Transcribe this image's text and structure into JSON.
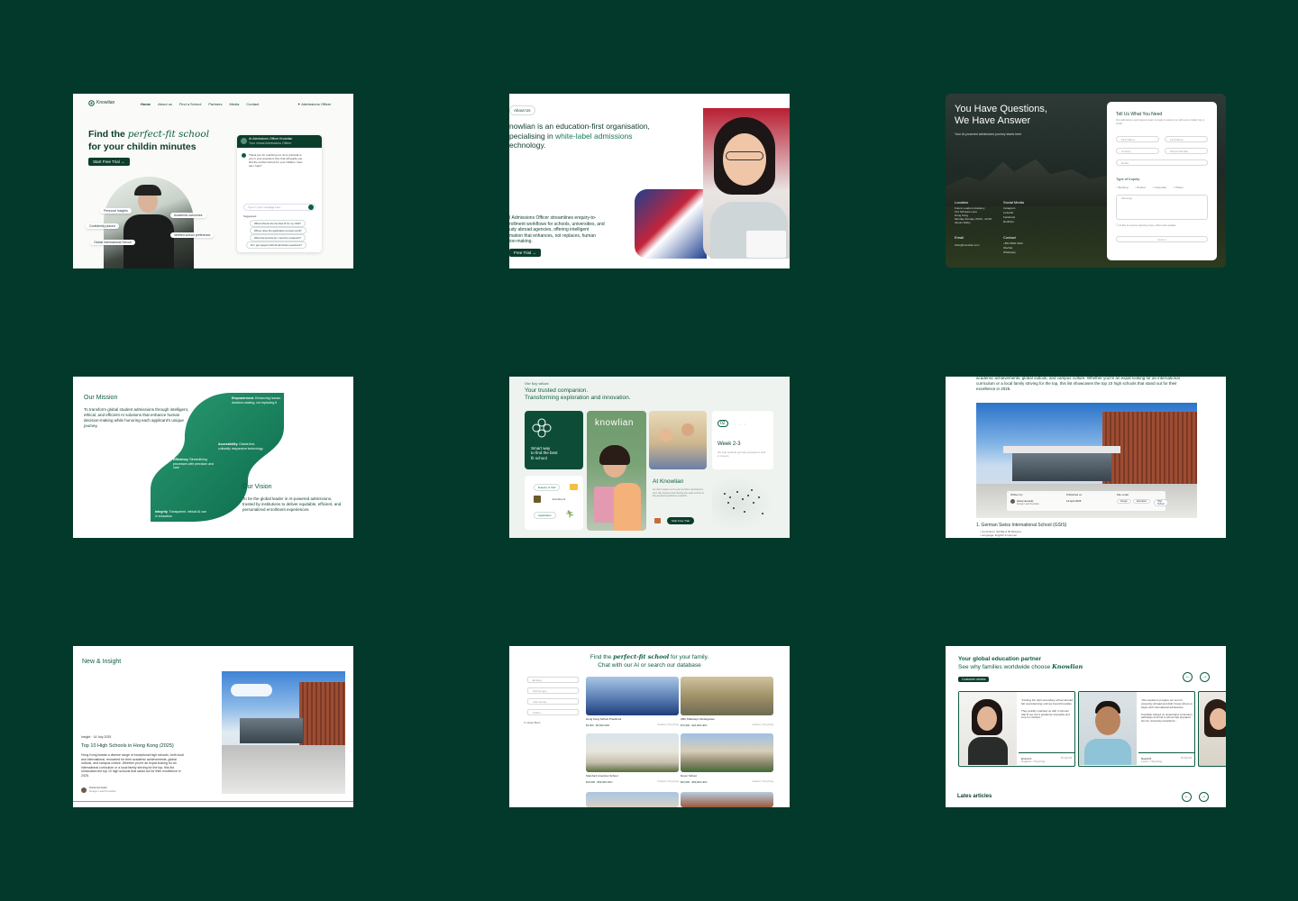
{
  "colors": {
    "page_bg": "#03392a",
    "brand": "#0f5c41",
    "brand_dark": "#0b3d2c",
    "accent_light": "#e8f3ee"
  },
  "hero": {
    "logo": "Knowlian",
    "nav": [
      "Home",
      "About us",
      "Find a School",
      "Partners",
      "Media",
      "Contact"
    ],
    "nav_cta": "Admissions Officer",
    "title_a": "Find the ",
    "title_em": "perfect-fit school",
    "title_b": "for your childin minutes",
    "cta": "Start Free Trial",
    "chat_header": "AI Admissions Officer Knowlian",
    "chat_sub": "Your virtual Admissions Officer",
    "chat_msg": "Thank you for reaching out. As a principal to you in your questions this chat will guide you find the perfect school for your children. How can i help?",
    "chat_input": "Type in your message here",
    "suggested": "Suggested",
    "suggestions": [
      "What schools are the best fit for my child?",
      "Where does the application process work?",
      "What documents do I need for prospects?",
      "Do I get support with all admission questions?"
    ],
    "chips": [
      "Personal Insights",
      "Confidently placed",
      "Global International School",
      "Academic outcomes",
      "Verified school preference"
    ]
  },
  "about": {
    "badge": "About Us",
    "heading_a": "nowlian is an education-first organisation,",
    "heading_b": "pecialising in ",
    "heading_hl": "white-label admissions",
    "heading_c": "echnology.",
    "para": "I Admissions Officer streamlines enquiry-to-\nrollment workflows for schools, universities, and\nudy abroad agencies, offering intelligent\nmation that enhances, not replaces, human\nion-making.",
    "cta": "Free Trial"
  },
  "contact": {
    "heading": "You Have Questions,\nWe Have Answer",
    "sub": "Your AI-powered admissions journey starts here",
    "location_label": "Location",
    "location": "Future Leaders Academy\n101 Scholars Lane\nHong Kong\nMonday-Sunday, 09:00 - 22:00\n(Hours Daily)",
    "social_label": "Social Media",
    "social": [
      "Instagram",
      "LinkedIn",
      "Facebook",
      "RedNote"
    ],
    "email_label": "Email",
    "email": "hello@knowlian.com",
    "contact_label": "Contact",
    "contact_values": [
      "+852 9800 4232",
      "Wechat",
      "WhatsApp"
    ],
    "form_title": "Tell Us What You Need",
    "form_sub": "Our admissions and support team is ready to assist you with every detail, big or small.",
    "fields": [
      "First Name",
      "Last Name",
      "Country",
      "Phone Number",
      "Email"
    ],
    "inquiry_label": "Type of Inquiry",
    "inquiry_options": [
      "Booking",
      "Partner",
      "Corporate",
      "Others"
    ],
    "message": "Message",
    "consent": "I'd like to receive learning news, offers and updates",
    "submit": "Submit"
  },
  "mission": {
    "mission_title": "Our Mission",
    "mission_text": "To transform global student admissions through intelligent, ethical, and efficient AI solutions that enhance human decision-making while honoring each applicant's unique journey.",
    "values": [
      {
        "title": "Empowerment.",
        "text": "Enhancing human decision-making, not replacing it"
      },
      {
        "title": "Accessibility.",
        "text": "Global-first, culturally responsive technology"
      },
      {
        "title": "Efficiency.",
        "text": "Streamlining processes with precision and care"
      },
      {
        "title": "Integrity.",
        "text": "Transparent, ethical AI use in education"
      }
    ],
    "vision_title": "Our Vision",
    "vision_text": "To be the global leader in AI-powered admissions, trusted by institutions to deliver equitable, efficient, and personalized enrollment experiences."
  },
  "values_card": {
    "kicker": "Our key values",
    "title_a": "Your trusted companion.",
    "title_b": "Transforming exploration and innovation.",
    "smart_text": "Smart way\nto find the best\nfit school",
    "brand": "knowlian",
    "week_num": "02",
    "week": "Week 2-3",
    "week_text": "We help students get fully prepared to land in Country",
    "steps": [
      "Enquiry & Visit",
      "Enrollment",
      "Application"
    ],
    "at_title": "At Knowlian",
    "at_text": "we don't aspire to be just another admissions tool. We believe that finding the right school is the greatest guidance possible.",
    "cta": "Start Free Trial"
  },
  "article": {
    "intro": "academic achievements, global outlook, and campus culture. Whether you're an expat looking for an international curriculum or a local family striving for the top, this list showcases the top 10 high schools that stand out for their excellence in 2025.",
    "written_by": "Written by",
    "author": "Oana Horowitz",
    "author_role": "Design Lead Knowlian",
    "published_label": "Published on",
    "published": "14 April 2025",
    "filed_label": "File under",
    "tags": [
      "Design",
      "Education",
      "High School"
    ],
    "item": "1. German Swiss International School (GSIS)",
    "bullets": [
      "Curriculum: IGCSE & IB Diploma",
      "Language: English & German"
    ]
  },
  "news": {
    "title": "New & Insight",
    "category": "Insight",
    "date": "14 July 2025",
    "headline": "Top 10 High Schools in Hong Kong (2025)",
    "body": "Hong Kong boasts a diverse range of exceptional high schools, both local and international, renowned for their academic achievements, global outlook, and campus culture. Whether you're an expat looking for an international curriculum or a local family striving for the top, this list showcases the top 10 high schools that stand out for their excellence in 2025.",
    "author": "Oana Horowitz",
    "author_role": "Design Lead Knowlian"
  },
  "finder": {
    "title_a": "Find the ",
    "title_em": "perfect-fit school",
    "title_b": " for your family.",
    "title_c": "Chat with our AI or search our database",
    "filters": [
      "Hong",
      "School type",
      "Year Group",
      "Tuition"
    ],
    "clear": "Clear filters",
    "schools": [
      {
        "name": "Hong Kong School Preschool",
        "price": "$3,900 - $6,500 HKD",
        "loc": "Kowloon, Hong Kong"
      },
      {
        "name": "ABC Pathways Kindergarten",
        "price": "$73,900 - $24,900 HKD",
        "loc": "Kowloon, Hong Kong"
      },
      {
        "name": "Stamford American School",
        "price": "$19,900 - $59,900 HKD",
        "loc": "Kowloon, Hong Kong"
      },
      {
        "name": "Dover School",
        "price": "$23,900 - $59,900 HKD",
        "loc": "Kowloon, Hong Kong"
      }
    ]
  },
  "partner": {
    "title_a": "Your global education partner",
    "title_b": "See why families worldwide choose ",
    "title_em": "Knowlian",
    "badge": "Customer stories",
    "stories": [
      {
        "quote": "\"Finding the right secondary school abroad felt overwhelming until we found Knowlian.\n\nThey quickly matched us with 3 schools that fit our son's academic strengths and love for robotics.\"",
        "name": "Emma K.",
        "loc": "Singapore - Hong Kong",
        "date": "7th April 25"
      },
      {
        "quote": "\"We needed to prepare our son for university abroad and didn't know where to begin with international admissions.\n\nKnowlian helped us understand curriculum pathways and find a school that prepared him for university transitions.\"",
        "name": "David M.",
        "loc": "London - Hong Kong",
        "date": "7th April 25"
      }
    ],
    "latest": "Lates articles"
  }
}
